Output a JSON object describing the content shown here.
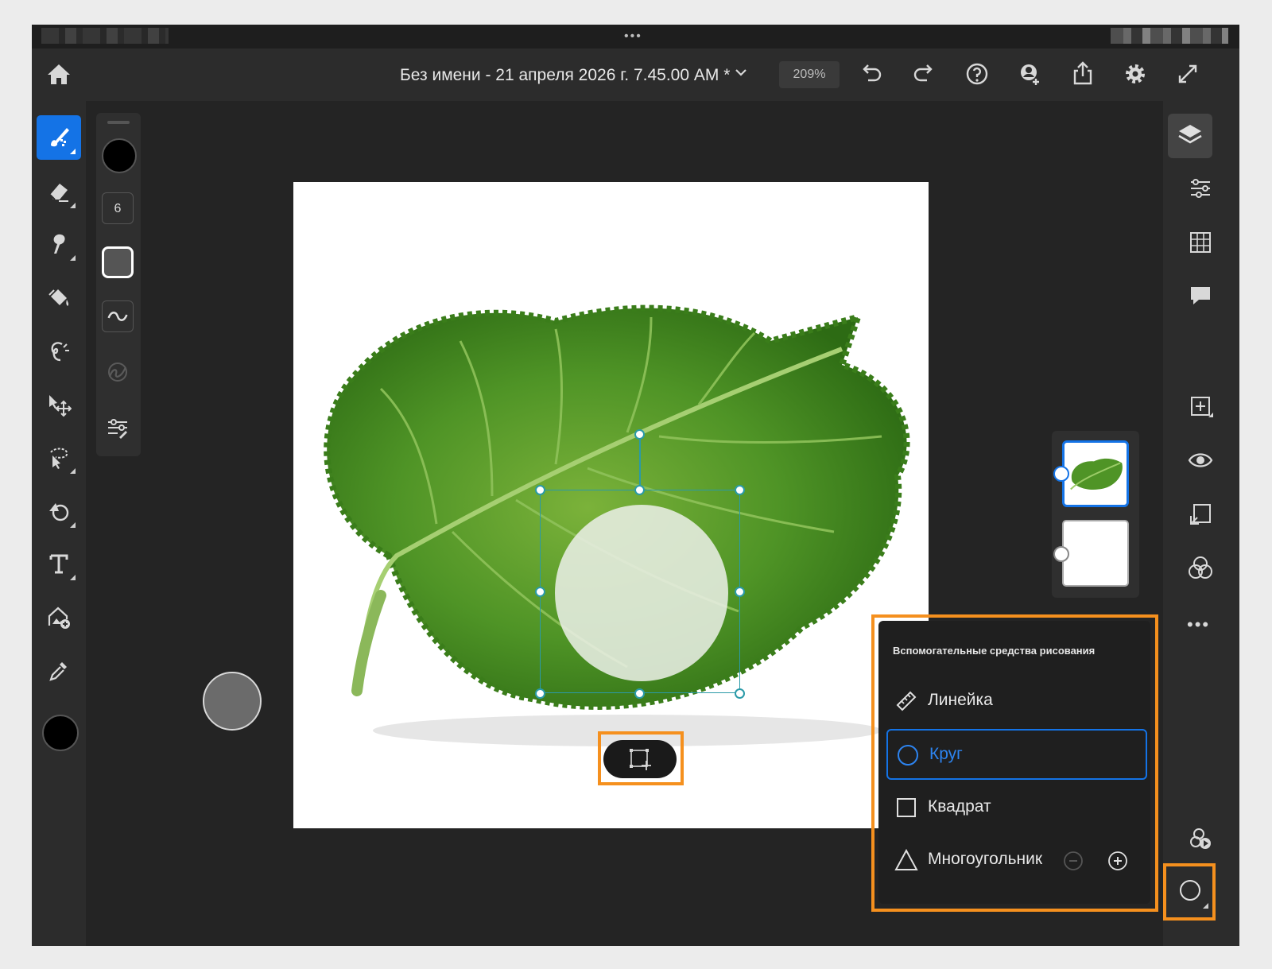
{
  "status_bar": {
    "dots": "•••"
  },
  "header": {
    "document_title": "Без имени - 21 апреля 2026 г. 7.45.00 AM *",
    "zoom": "209%",
    "icons": [
      "home-icon",
      "chevron-down-icon",
      "undo-icon",
      "redo-icon",
      "help-icon",
      "invite-icon",
      "share-icon",
      "settings-icon",
      "fullscreen-icon"
    ]
  },
  "brush_panel": {
    "brush_size": "6"
  },
  "tools": [
    "brush",
    "eraser",
    "smudge",
    "paint-bucket",
    "lasso",
    "move",
    "select",
    "shape-fill",
    "text",
    "place-image",
    "eyedropper"
  ],
  "right_rail": {
    "more": "•••"
  },
  "drawing_aids": {
    "title": "Вспомогательные средства рисования",
    "items": [
      {
        "label": "Линейка"
      },
      {
        "label": "Круг"
      },
      {
        "label": "Квадрат"
      },
      {
        "label": "Многоугольник"
      }
    ],
    "selected": "Круг"
  },
  "colors": {
    "accent": "#1473e6",
    "highlight": "#f5901e",
    "selection": "#2a9aa8"
  }
}
